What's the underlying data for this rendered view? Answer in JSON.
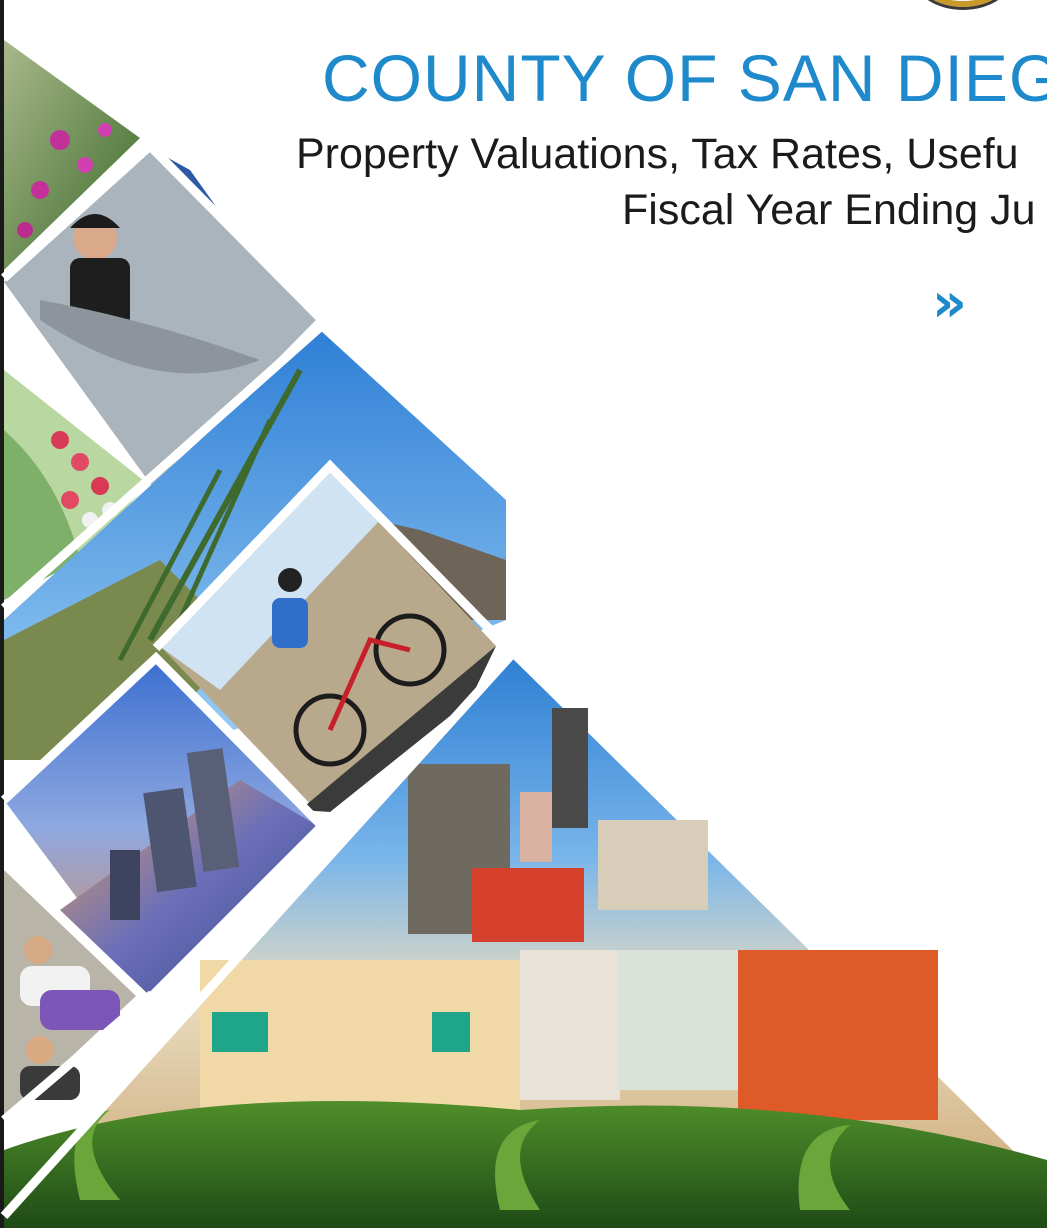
{
  "document": {
    "title": "COUNTY OF SAN DIEG",
    "subtitle_line1": "Property Valuations, Tax Rates, Usefu",
    "subtitle_line2": "Fiscal Year Ending Ju",
    "next_icon": "double-chevron-right-icon",
    "accent_color": "#1e8acb"
  },
  "collage": {
    "photos": [
      "flowers-photo",
      "fisherman-photo",
      "radishes-photo",
      "desert-plant-photo",
      "cyclist-photo",
      "skyline-night-photo",
      "yoga-class-photo",
      "downtown-buildings-photo"
    ]
  }
}
